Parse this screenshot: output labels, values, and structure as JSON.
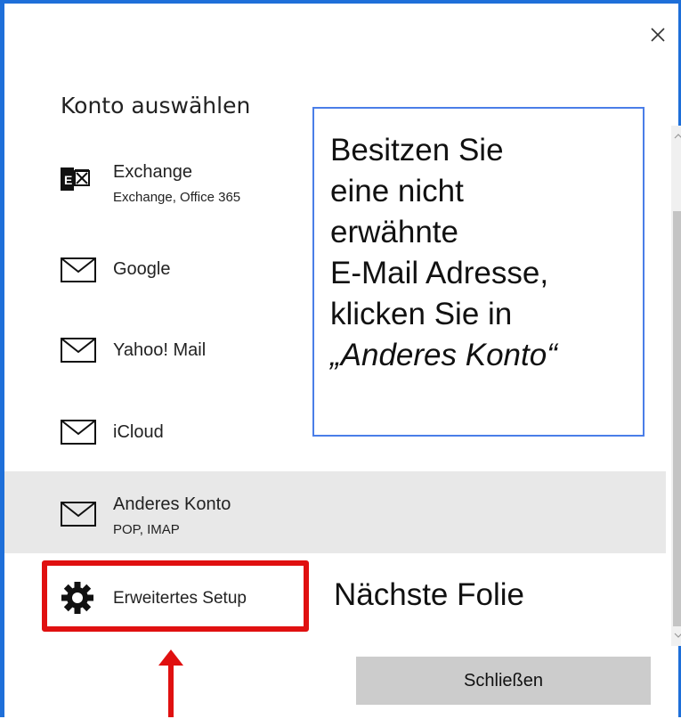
{
  "dialog": {
    "title": "Konto auswählen",
    "close_icon": "close-icon",
    "accounts": [
      {
        "name": "Exchange",
        "sub": "Exchange, Office 365",
        "icon": "exchange-icon"
      },
      {
        "name": "Google",
        "sub": "",
        "icon": "mail-icon"
      },
      {
        "name": "Yahoo! Mail",
        "sub": "",
        "icon": "mail-icon"
      },
      {
        "name": "iCloud",
        "sub": "",
        "icon": "mail-icon"
      },
      {
        "name": "Anderes Konto",
        "sub": "POP, IMAP",
        "icon": "mail-icon",
        "selected": true
      },
      {
        "name": "Erweitertes Setup",
        "sub": "",
        "icon": "gear-icon"
      }
    ],
    "close_button_label": "Schließen"
  },
  "annotations": {
    "callout_lines": [
      "Besitzen Sie",
      "eine nicht",
      "erwähnte",
      "E-Mail Adresse,",
      "klicken Sie in",
      "„Anderes Konto“"
    ],
    "next_slide_label": "Nächste Folie"
  },
  "colors": {
    "frame_border": "#1e6fd9",
    "callout_border": "#4a7ee8",
    "highlight": "#e01010",
    "selected_row": "#e8e8e8",
    "button": "#cccccc"
  }
}
